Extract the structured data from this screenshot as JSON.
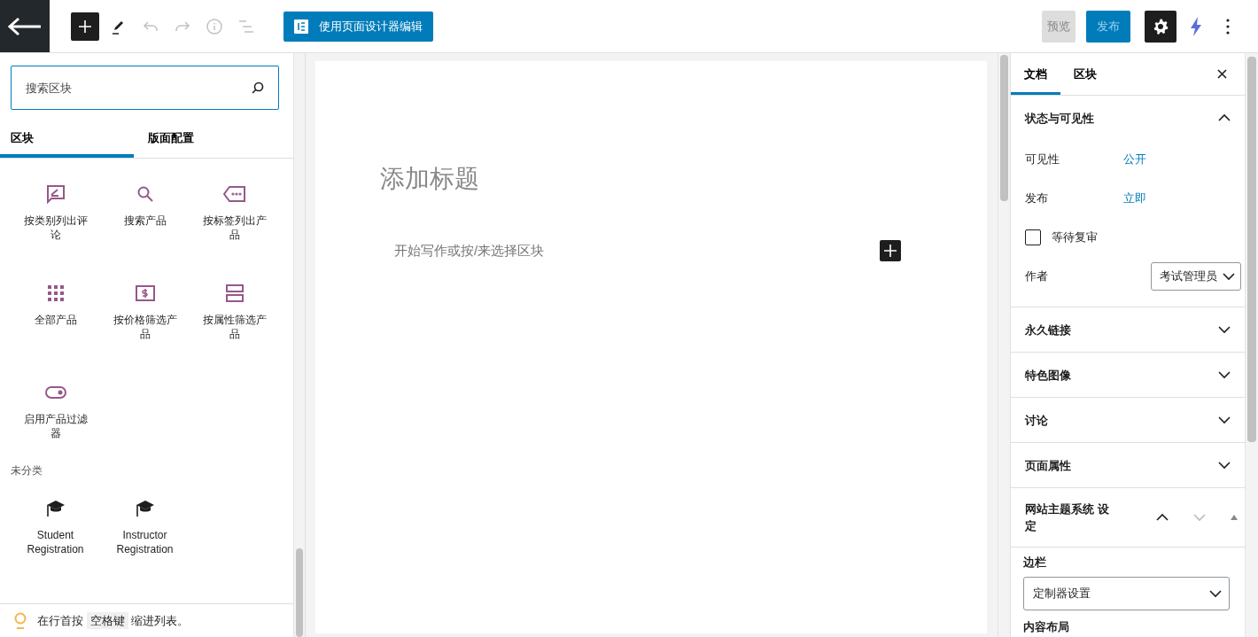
{
  "toolbar": {
    "tools": [
      {
        "kind": "inserter",
        "disabled": false
      },
      {
        "kind": "tools",
        "disabled": false
      },
      {
        "kind": "undo",
        "disabled": true
      },
      {
        "kind": "redo",
        "disabled": true
      },
      {
        "kind": "info",
        "disabled": true
      },
      {
        "kind": "outline",
        "disabled": true
      }
    ],
    "designer_button": "使用页面设计器编辑",
    "preview": "预览",
    "publish": "发布",
    "settings_selected": true
  },
  "inserter": {
    "search": {
      "placeholder": "搜索区块"
    },
    "tabs": [
      {
        "label": "区块",
        "selected": true
      },
      {
        "label": "版面配置",
        "selected": false
      }
    ],
    "groups": [
      {
        "blocks": [
          {
            "label": "按类别列出评论",
            "kind": "comment"
          },
          {
            "label": "搜索产品",
            "kind": "search"
          },
          {
            "label": "按标签列出产品",
            "kind": "tag"
          },
          {
            "label": "全部产品",
            "kind": "grid"
          },
          {
            "label": "按价格筛选产品",
            "kind": "price"
          },
          {
            "label": "按属性筛选产品",
            "kind": "attributes"
          },
          {
            "label": "启用产品过滤器",
            "kind": "toggle"
          }
        ]
      },
      {
        "title": "未分类",
        "blocks": [
          {
            "label": "Student Registration",
            "kind": "cap"
          },
          {
            "label": "Instructor Registration",
            "kind": "cap"
          }
        ]
      }
    ],
    "tip": {
      "before": "在行首按",
      "key": "空格键",
      "after": "缩进列表。"
    }
  },
  "editor": {
    "title_placeholder": "添加标题",
    "paragraph_placeholder": "开始写作或按/来选择区块"
  },
  "sidebar": {
    "tabs": [
      {
        "label": "文档",
        "selected": true
      },
      {
        "label": "区块",
        "selected": false
      }
    ],
    "panels": [
      {
        "title": "状态与可见性",
        "expanded": true,
        "rows": [
          {
            "kind": "link",
            "label": "可见性",
            "value": "公开"
          },
          {
            "kind": "link",
            "label": "发布",
            "value": "立即"
          },
          {
            "kind": "checkbox",
            "label": "等待复审",
            "checked": false
          },
          {
            "kind": "select",
            "label": "作者",
            "value": "考试管理员"
          }
        ]
      },
      {
        "title": "永久链接",
        "expanded": false
      },
      {
        "title": "特色图像",
        "expanded": false
      },
      {
        "title": "讨论",
        "expanded": false
      },
      {
        "title": "页面属性",
        "expanded": false
      },
      {
        "title": "网站主题系统 设定",
        "expanded": true,
        "movable": true,
        "rows": [
          {
            "kind": "field-select",
            "label": "边栏",
            "value": "定制器设置"
          },
          {
            "kind": "label",
            "label": "内容布局"
          }
        ]
      }
    ]
  }
}
